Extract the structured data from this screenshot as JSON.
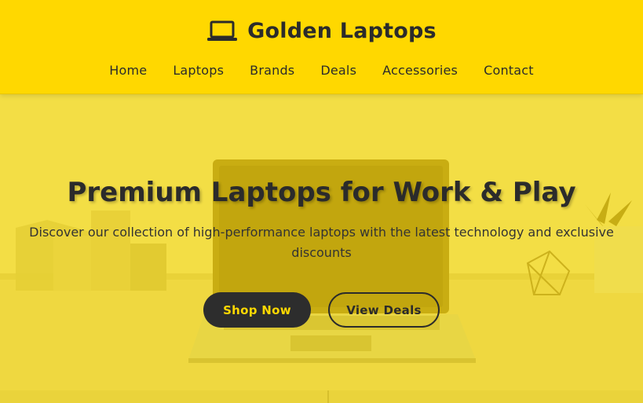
{
  "header": {
    "brand_name": "Golden Laptops",
    "brand_icon": "laptop-icon",
    "nav": [
      {
        "label": "Home"
      },
      {
        "label": "Laptops"
      },
      {
        "label": "Brands"
      },
      {
        "label": "Deals"
      },
      {
        "label": "Accessories"
      },
      {
        "label": "Contact"
      }
    ]
  },
  "hero": {
    "title": "Premium Laptops for Work & Play",
    "subtitle": "Discover our collection of high-performance laptops with the latest technology and exclusive discounts",
    "primary_button": "Shop Now",
    "secondary_button": "View Deals"
  },
  "colors": {
    "brand_yellow": "#ffd800",
    "dark": "#2d2d2d",
    "overlay_yellow": "#f2dd3a"
  }
}
